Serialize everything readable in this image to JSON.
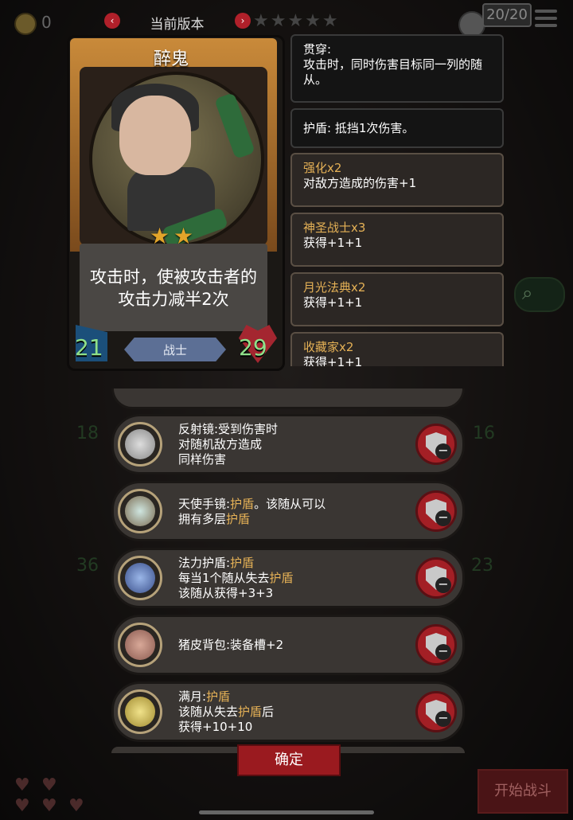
{
  "top_bar": {
    "coins": "0",
    "version_label": "当前版本",
    "prev_icon": "chevron-left-icon",
    "next_icon": "chevron-right-icon",
    "turn": "20/20"
  },
  "card": {
    "name": "醉鬼",
    "stars": 2,
    "description": "攻击时，使被攻击者的攻击力减半2次",
    "attack": "21",
    "health": "29",
    "class": "战士"
  },
  "keywords": [
    {
      "title": "贯穿:",
      "body": "攻击时，同时伤害目标同一列的随从。"
    },
    {
      "title": "护盾: 抵挡1次伤害。",
      "body": ""
    },
    {
      "title": "强化x2",
      "body": "对敌方造成的伤害+1"
    },
    {
      "title": "神圣战士x3",
      "body": "获得+1+1"
    },
    {
      "title": "月光法典x2",
      "body": "获得+1+1"
    },
    {
      "title": "收藏家x2",
      "body": "获得+1+1"
    }
  ],
  "background_stats": [
    "18",
    "16",
    "36",
    "23"
  ],
  "items": [
    {
      "name": "反射镜:受到伤害时",
      "line2": "对随机敌方造成",
      "line3": "同样伤害",
      "icon": "mirror-icon"
    },
    {
      "name": "天使手镜:",
      "hl": "护盾",
      "rest": "。该随从可以",
      "line2a": "拥有多层",
      "line2b": "护盾",
      "icon": "hand-mirror-icon"
    },
    {
      "name": "法力护盾:",
      "hl": "护盾",
      "line2a": "每当1个随从失去",
      "line2b": "护盾",
      "line3": "该随从获得+3+3",
      "icon": "mana-shield-icon"
    },
    {
      "name": "猪皮背包:装备槽+2",
      "icon": "pig-backpack-icon"
    },
    {
      "name": "满月:",
      "hl": "护盾",
      "line2a": "该随从失去",
      "line2b": "护盾",
      "line2c": "后",
      "line3": "获得+10+10",
      "icon": "full-moon-icon"
    }
  ],
  "confirm_label": "确定",
  "start_battle_label": "开始战斗"
}
